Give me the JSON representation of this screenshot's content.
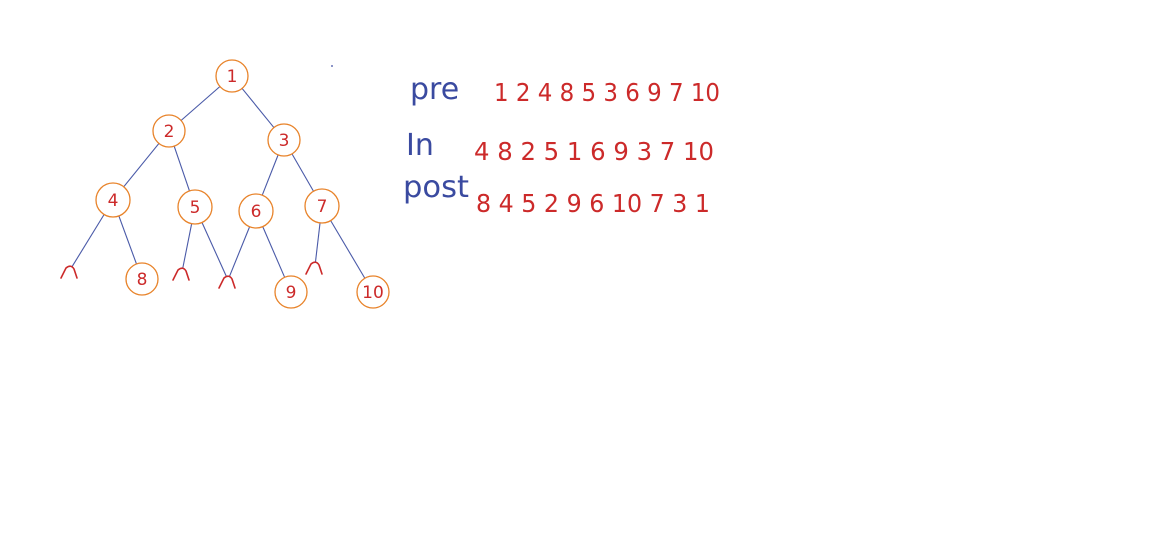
{
  "colors": {
    "edge": "#4a5aa8",
    "node_stroke": "#e8832a",
    "node_text": "#cc2a2a",
    "label_text": "#3a4aa0",
    "sequence_text": "#cc2a2a"
  },
  "tree": {
    "nodes": [
      {
        "id": "n1",
        "label": "1"
      },
      {
        "id": "n2",
        "label": "2"
      },
      {
        "id": "n3",
        "label": "3"
      },
      {
        "id": "n4",
        "label": "4"
      },
      {
        "id": "n5",
        "label": "5"
      },
      {
        "id": "n6",
        "label": "6"
      },
      {
        "id": "n7",
        "label": "7"
      },
      {
        "id": "n8",
        "label": "8"
      },
      {
        "id": "n9",
        "label": "9"
      },
      {
        "id": "n10",
        "label": "10"
      }
    ],
    "edges": [
      {
        "from": "n1",
        "to": "n2"
      },
      {
        "from": "n1",
        "to": "n3"
      },
      {
        "from": "n2",
        "to": "n4"
      },
      {
        "from": "n2",
        "to": "n5"
      },
      {
        "from": "n3",
        "to": "n6"
      },
      {
        "from": "n3",
        "to": "n7"
      },
      {
        "from": "n4",
        "to": "null_a"
      },
      {
        "from": "n4",
        "to": "n8"
      },
      {
        "from": "n5",
        "to": "null_b"
      },
      {
        "from": "n5",
        "to": "null_c"
      },
      {
        "from": "n6",
        "to": "null_c"
      },
      {
        "from": "n6",
        "to": "n9"
      },
      {
        "from": "n7",
        "to": "null_d"
      },
      {
        "from": "n7",
        "to": "n10"
      }
    ],
    "null_markers": [
      "null_a",
      "null_b",
      "null_c",
      "null_d"
    ]
  },
  "traversals": [
    {
      "label": "pre",
      "sequence": "1 2 4 8 5 3 6 9 7 10"
    },
    {
      "label": "In",
      "sequence": "4 8 2 5 1 6 9 3 7 10"
    },
    {
      "label": "post",
      "sequence": "8 4 5 2 9 6 10 7 3 1"
    }
  ]
}
